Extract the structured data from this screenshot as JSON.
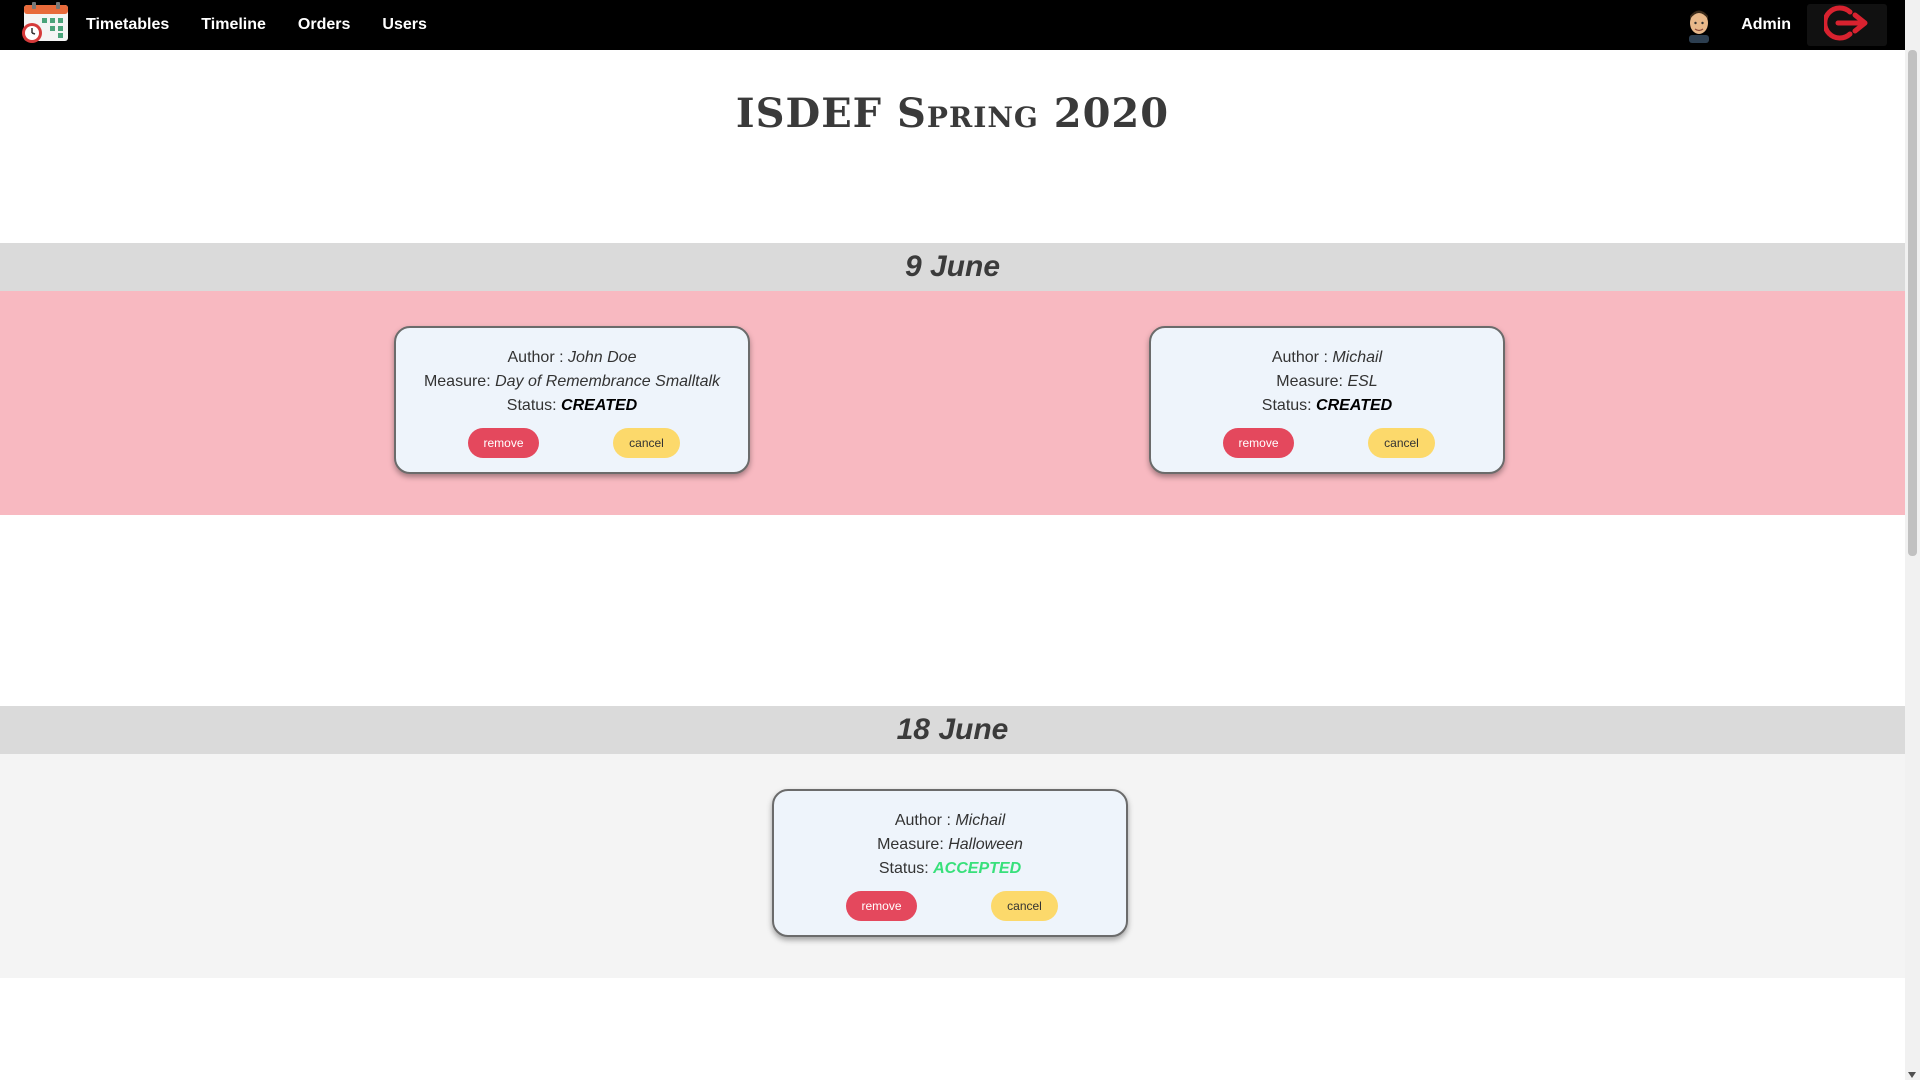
{
  "nav": {
    "logo_icon": "calendar-clock-icon",
    "links": [
      "Timetables",
      "Timeline",
      "Orders",
      "Users"
    ],
    "user_label": "Admin",
    "avatar_icon": "user-avatar-icon",
    "logout_icon": "logout-icon"
  },
  "page_title": "ISDEF Spring 2020",
  "days": [
    {
      "date": "9 June",
      "background": "#f8b9c1",
      "orders": [
        {
          "author_label": "Author : ",
          "author": "John Doe",
          "measure_label": "Measure: ",
          "measure": "Day of Remembrance Smalltalk",
          "status_label": "Status: ",
          "status": "CREATED",
          "remove_label": "remove",
          "cancel_label": "cancel"
        },
        {
          "author_label": "Author : ",
          "author": "Michail",
          "measure_label": "Measure: ",
          "measure": "ESL",
          "status_label": "Status: ",
          "status": "CREATED",
          "remove_label": "remove",
          "cancel_label": "cancel"
        }
      ]
    },
    {
      "date": "18 June",
      "background": "#f4f4f4",
      "orders": [
        {
          "author_label": "Author : ",
          "author": "Michail",
          "measure_label": "Measure: ",
          "measure": "Halloween",
          "status_label": "Status: ",
          "status": "ACCEPTED",
          "remove_label": "remove",
          "cancel_label": "cancel"
        }
      ]
    }
  ],
  "colors": {
    "navbar": "#000000",
    "remove_button": "#e4485d",
    "cancel_button": "#fcd96b",
    "status_accepted": "#38e07b",
    "status_created": "#000000"
  }
}
